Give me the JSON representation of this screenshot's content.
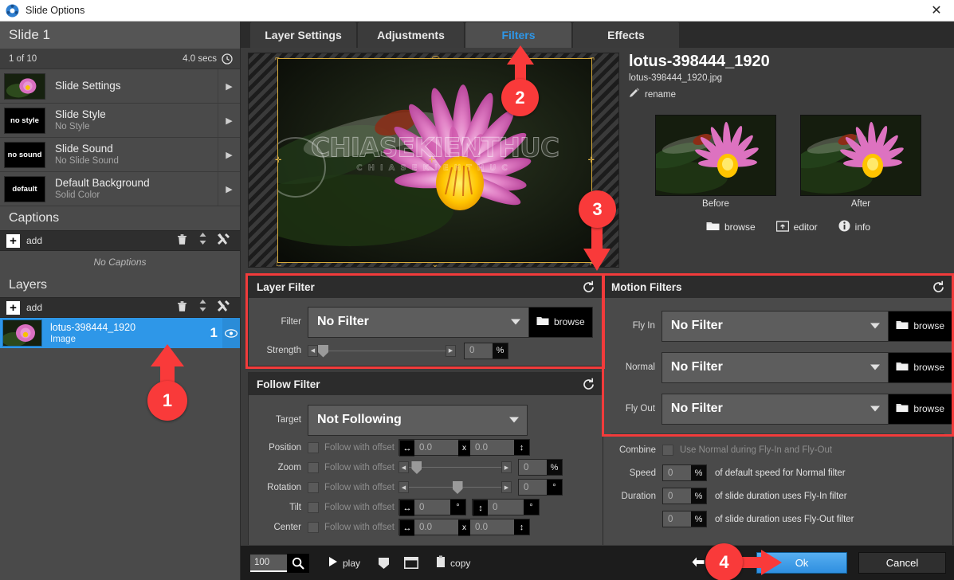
{
  "window": {
    "title": "Slide Options",
    "app_icon": "app-icon",
    "close_label": "✕"
  },
  "sidebar": {
    "slide_title": "Slide 1",
    "index_label": "1 of 10",
    "duration_label": "4.0 secs",
    "rows": [
      {
        "thumb": "",
        "title": "Slide Settings",
        "subtitle": "",
        "arrow": "▶"
      },
      {
        "thumb": "no style",
        "title": "Slide Style",
        "subtitle": "No Style",
        "arrow": "▶"
      },
      {
        "thumb": "no sound",
        "title": "Slide Sound",
        "subtitle": "No Slide Sound",
        "arrow": "▶"
      },
      {
        "thumb": "default",
        "title": "Default Background",
        "subtitle": "Solid Color",
        "arrow": "▶"
      }
    ],
    "captions": {
      "heading": "Captions",
      "add_label": "add",
      "empty_text": "No Captions",
      "tools": [
        "trash-icon",
        "reorder-icon",
        "tools-icon"
      ]
    },
    "layers": {
      "heading": "Layers",
      "add_label": "add",
      "tools": [
        "trash-icon",
        "reorder-icon",
        "tools-icon"
      ],
      "items": [
        {
          "name": "lotus-398444_1920",
          "type": "Image",
          "number": "1",
          "visible_icon": "eye-icon"
        }
      ]
    }
  },
  "main": {
    "tabs": [
      {
        "label": "Layer Settings",
        "active": false
      },
      {
        "label": "Adjustments",
        "active": false
      },
      {
        "label": "Filters",
        "active": true
      },
      {
        "label": "Effects",
        "active": false
      }
    ],
    "preview": {
      "watermark": "CHIASEKIENTHUC",
      "watermark_sub": "CHIASEKIENTHUC"
    },
    "info": {
      "file_title": "lotus-398444_1920",
      "file_name": "lotus-398444_1920.jpg",
      "rename_label": "rename",
      "rename_icon": "pencil-icon",
      "before_label": "Before",
      "after_label": "After",
      "actions": [
        {
          "label": "browse",
          "icon": "folder-icon"
        },
        {
          "label": "editor",
          "icon": "editor-icon"
        },
        {
          "label": "info",
          "icon": "info-icon"
        }
      ]
    },
    "layer_filter": {
      "title": "Layer Filter",
      "reset_icon": "reset-icon",
      "filter_label": "Filter",
      "filter_value": "No Filter",
      "browse_label": "browse",
      "strength_label": "Strength",
      "strength_value": "0",
      "strength_unit": "%"
    },
    "follow_filter": {
      "title": "Follow Filter",
      "reset_icon": "reset-icon",
      "target_label": "Target",
      "target_value": "Not Following",
      "offset_label": "Follow with offset",
      "rows": [
        {
          "label": "Position",
          "kind": "xy",
          "v1": "0.0",
          "sep": "x",
          "v2": "0.0",
          "unit1": "↔",
          "unit2": "↕"
        },
        {
          "label": "Zoom",
          "kind": "slider",
          "value": "0",
          "unit": "%",
          "thumb_pct": 5
        },
        {
          "label": "Rotation",
          "kind": "slider",
          "value": "0",
          "unit": "°",
          "thumb_pct": 49
        },
        {
          "label": "Tilt",
          "kind": "deg2",
          "v1": "0",
          "v2": "0",
          "unit1": "↔",
          "unit2": "↕",
          "deg": "°"
        },
        {
          "label": "Center",
          "kind": "xy",
          "v1": "0.0",
          "sep": "x",
          "v2": "0.0",
          "unit1": "↔",
          "unit2": "↕"
        }
      ]
    },
    "motion_filters": {
      "title": "Motion Filters",
      "reset_icon": "reset-icon",
      "browse_label": "browse",
      "rows": [
        {
          "label": "Fly In",
          "value": "No Filter"
        },
        {
          "label": "Normal",
          "value": "No Filter"
        },
        {
          "label": "Fly Out",
          "value": "No Filter"
        }
      ],
      "combine_label": "Combine",
      "combine_text": "Use Normal during Fly-In and Fly-Out",
      "speed_label": "Speed",
      "speed_value": "0",
      "speed_unit": "%",
      "speed_text": "of default speed for Normal filter",
      "duration_label": "Duration",
      "duration_value": "0",
      "duration_unit": "%",
      "duration_text": "of slide duration uses Fly-In filter",
      "duration2_value": "0",
      "duration2_unit": "%",
      "duration2_text": "of slide duration uses Fly-Out filter"
    },
    "bottom_bar": {
      "zoom_value": "100",
      "zoom_icon": "magnifier-icon",
      "play_label": "play",
      "play_icon": "play-icon",
      "shield_icon": "shield-icon",
      "window-icon": "window-icon",
      "copy_label": "copy",
      "copy_icon": "clipboard-icon",
      "previous_label": "previous",
      "previous_icon": "arrow-left-icon",
      "ok_label": "Ok",
      "cancel_label": "Cancel"
    }
  },
  "callouts": [
    {
      "number": "1",
      "direction": "up"
    },
    {
      "number": "2",
      "direction": "up"
    },
    {
      "number": "3",
      "direction": "down"
    },
    {
      "number": "4",
      "direction": "right"
    }
  ],
  "colors": {
    "accent_blue": "#2e97e8",
    "callout_red": "#f93a3a",
    "panel_bg": "#4a4a4a",
    "header_bg": "#2c2c2c"
  }
}
